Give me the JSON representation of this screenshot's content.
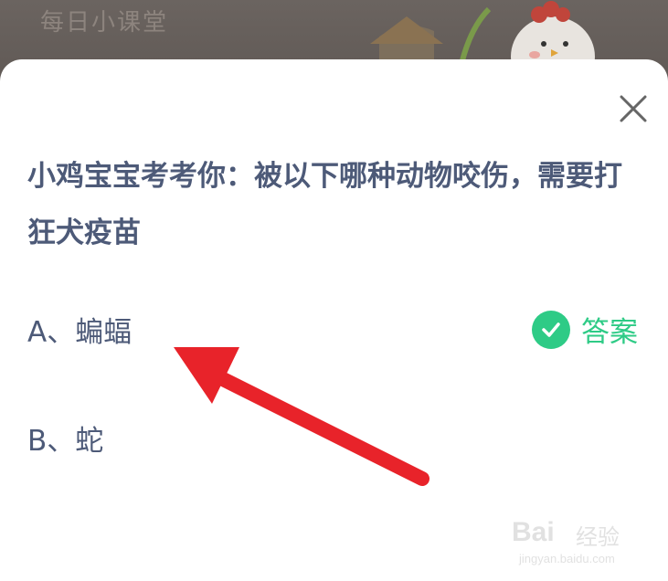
{
  "header": {
    "title": "每日小课堂"
  },
  "question": {
    "text": "小鸡宝宝考考你：被以下哪种动物咬伤，需要打狂犬疫苗"
  },
  "options": [
    {
      "label": "A、蝙蝠"
    },
    {
      "label": "B、蛇"
    }
  ],
  "answer": {
    "label": "答案",
    "color": "#2ecb86"
  },
  "watermark": {
    "brand": "Bai",
    "sub": "经验",
    "url": "jingyan.baidu.com"
  },
  "colors": {
    "text": "#4d5a78",
    "arrow": "#e8232a",
    "overlay": "#5a5552"
  }
}
